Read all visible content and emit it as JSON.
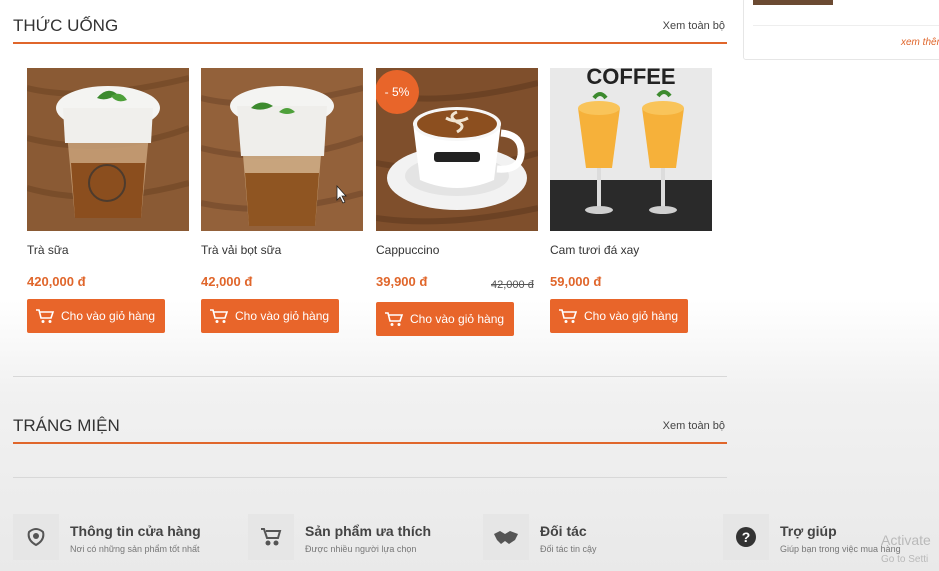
{
  "sections": {
    "drinks": {
      "title": "THỨC UỐNG",
      "view_all": "Xem toàn bộ"
    },
    "desserts": {
      "title": "TRÁNG MIỆN",
      "view_all": "Xem toàn bộ"
    }
  },
  "products": [
    {
      "name": "Trà sữa",
      "price": "420,000 đ",
      "cart_label": "Cho vào giỏ hàng"
    },
    {
      "name": "Trà vải bọt sữa",
      "price": "42,000 đ",
      "cart_label": "Cho vào giỏ hàng"
    },
    {
      "name": "Cappuccino",
      "price": "39,900 đ",
      "old_price": "42,000 đ",
      "sale_badge": "- 5%",
      "cart_label": "Cho vào giỏ hàng"
    },
    {
      "name": "Cam tươi đá xay",
      "price": "59,000 đ",
      "cart_label": "Cho vào giỏ hàng"
    }
  ],
  "sidebar": {
    "see_more": "xem thêm"
  },
  "info_bar": [
    {
      "title": "Thông tin cửa hàng",
      "subtitle": "Nơi có những sản phẩm tốt nhất",
      "icon": "store-info-icon"
    },
    {
      "title": "Sản phẩm ưa thích",
      "subtitle": "Được nhiều người lựa chọn",
      "icon": "stroller-icon"
    },
    {
      "title": "Đối tác",
      "subtitle": "Đối tác tin cậy",
      "icon": "handshake-icon"
    },
    {
      "title": "Trợ giúp",
      "subtitle": "Giúp bạn trong việc mua hàng",
      "icon": "help-icon"
    }
  ],
  "watermark": {
    "line1": "Activate",
    "line2": "Go to Setti"
  },
  "colors": {
    "accent": "#e8652a",
    "text": "#333333"
  }
}
